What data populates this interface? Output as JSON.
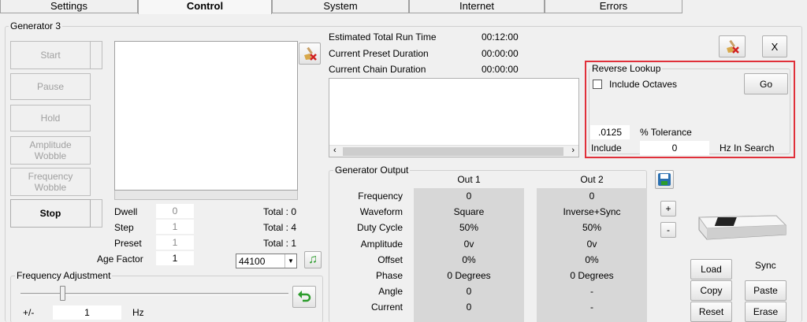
{
  "tabs": [
    "Settings",
    "Control",
    "System",
    "Internet",
    "Errors"
  ],
  "generator": {
    "title": "Generator 3",
    "buttons": {
      "start": "Start",
      "pause": "Pause",
      "hold": "Hold",
      "amplitude_wobble": "Amplitude Wobble",
      "frequency_wobble": "Frequency Wobble",
      "stop": "Stop"
    },
    "dwell_label": "Dwell",
    "dwell_value": "0",
    "dwell_total": "Total : 0",
    "step_label": "Step",
    "step_value": "1",
    "step_total": "Total : 4",
    "preset_label": "Preset",
    "preset_value": "1",
    "preset_total": "Total : 1",
    "age_factor_label": "Age Factor",
    "age_factor_value": "1",
    "sample_rate": "44100"
  },
  "frequency_adjustment": {
    "title": "Frequency Adjustment",
    "plusminus_label": "+/-",
    "value": "1",
    "unit": "Hz",
    "slider_level": 0.16
  },
  "timing": {
    "estimated_total_label": "Estimated Total Run Time",
    "estimated_total_value": "00:12:00",
    "preset_duration_label": "Current Preset Duration",
    "preset_duration_value": "00:00:00",
    "chain_duration_label": "Current Chain Duration",
    "chain_duration_value": "00:00:00"
  },
  "close_label": "X",
  "reverse_lookup": {
    "title": "Reverse Lookup",
    "include_octaves": "Include Octaves",
    "go": "Go",
    "tolerance_value": ".0125",
    "tolerance_label": "% Tolerance",
    "include_label": "Include",
    "include_value": "0",
    "hz_label": "Hz In Search"
  },
  "output": {
    "title": "Generator Output",
    "col1": "Out 1",
    "col2": "Out 2",
    "rows": [
      {
        "label": "Frequency",
        "out1": "0",
        "out2": "0"
      },
      {
        "label": "Waveform",
        "out1": "Square",
        "out2": "Inverse+Sync"
      },
      {
        "label": "Duty Cycle",
        "out1": "50%",
        "out2": "50%"
      },
      {
        "label": "Amplitude",
        "out1": "0v",
        "out2": "0v"
      },
      {
        "label": "Offset",
        "out1": "0%",
        "out2": "0%"
      },
      {
        "label": "Phase",
        "out1": "0 Degrees",
        "out2": "0 Degrees"
      },
      {
        "label": "Angle",
        "out1": "0",
        "out2": "-"
      },
      {
        "label": "Current",
        "out1": "0",
        "out2": "-"
      }
    ],
    "plus": "+",
    "minus": "-"
  },
  "device_buttons": {
    "load": "Load",
    "sync": "Sync",
    "copy": "Copy",
    "paste": "Paste",
    "reset": "Reset",
    "erase": "Erase"
  },
  "colors": {
    "highlight": "#e0303a",
    "grey_panel": "#d7d7d7"
  }
}
